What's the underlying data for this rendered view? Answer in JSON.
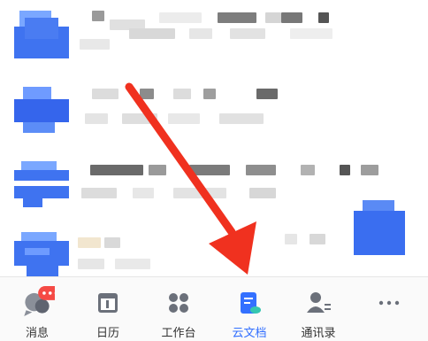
{
  "tabs": [
    {
      "label": "消息",
      "icon": "chat-bubbles-icon",
      "active": false,
      "has_badge": true
    },
    {
      "label": "日历",
      "icon": "calendar-icon",
      "active": false,
      "has_badge": false
    },
    {
      "label": "工作台",
      "icon": "grid-apps-icon",
      "active": false,
      "has_badge": false
    },
    {
      "label": "云文档",
      "icon": "cloud-doc-icon",
      "active": true,
      "has_badge": false
    },
    {
      "label": "通讯录",
      "icon": "contacts-icon",
      "active": false,
      "has_badge": false
    },
    {
      "label": "",
      "icon": "more-icon",
      "active": false,
      "has_badge": false
    }
  ],
  "colors": {
    "accent": "#3370ff",
    "badge": "#f54a45",
    "arrow": "#f0311f"
  }
}
